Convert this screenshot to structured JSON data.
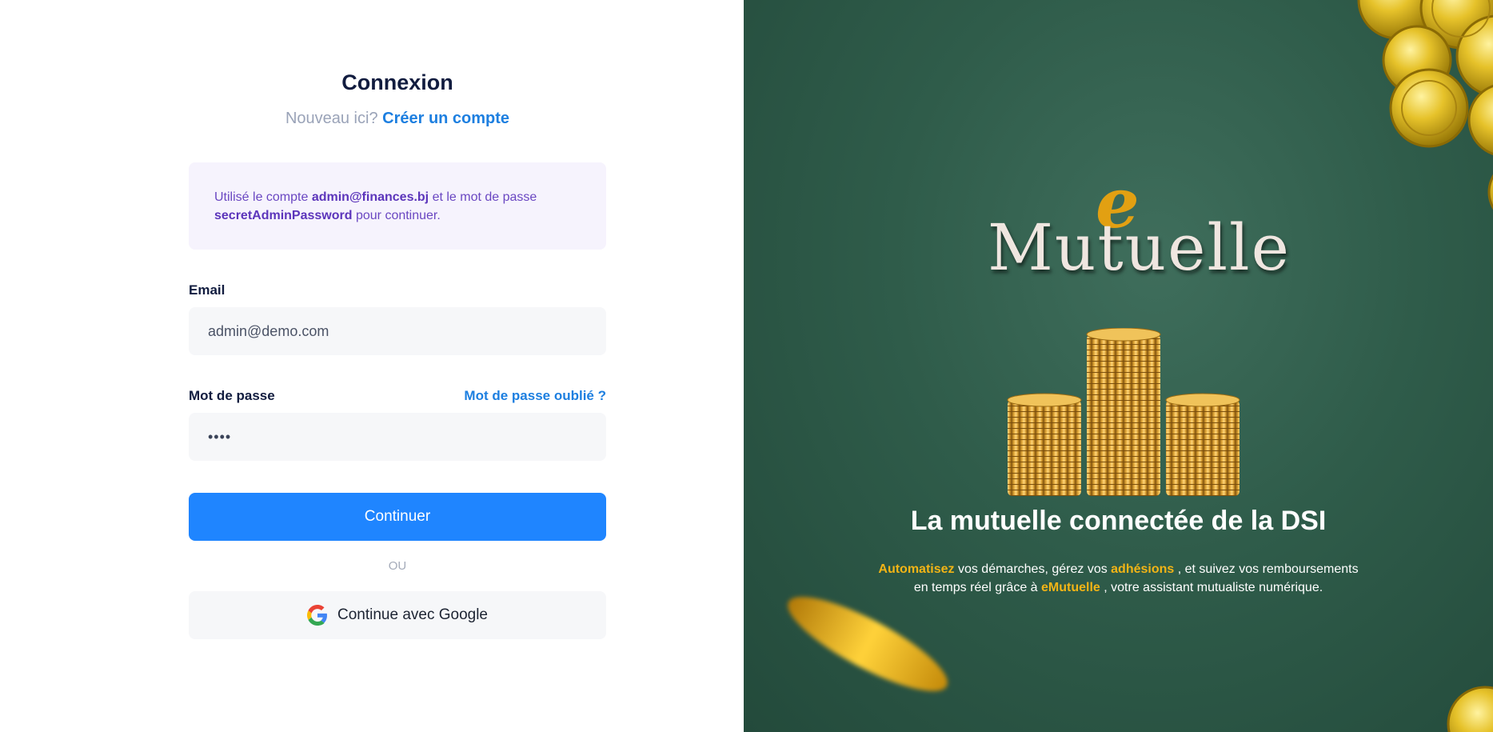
{
  "login": {
    "title": "Connexion",
    "subtitle_text": "Nouveau ici?",
    "create_account_link": "Créer un compte",
    "notice": {
      "prefix": "Utilisé le compte",
      "email": "admin@finances.bj",
      "middle": "et le mot de passe",
      "password": "secretAdminPassword",
      "suffix": "pour continuer."
    },
    "email_label": "Email",
    "email_value": "admin@demo.com",
    "password_label": "Mot de passe",
    "forgot_link": "Mot de passe oublié ?",
    "password_value": "••••",
    "continue_button": "Continuer",
    "or_separator": "OU",
    "google_button": "Continue avec Google"
  },
  "hero": {
    "logo_e": "e",
    "logo_word": "Mutuelle",
    "headline": "La mutuelle connectée de la DSI",
    "desc": {
      "hl1": "Automatisez",
      "t1": " vos démarches, gérez vos ",
      "hl2": "adhésions",
      "t2": " , et suivez vos remboursements",
      "t3": "en temps réel grâce à ",
      "hl3": "eMutuelle",
      "t4": " , votre assistant mutualiste numérique."
    }
  },
  "colors": {
    "primary": "#1f85ff",
    "link": "#1d7fe0",
    "hero_bg": "#2f5c4a",
    "accent_gold": "#f2b416",
    "notice_bg": "#f6f3fd",
    "notice_text": "#6a47c2"
  },
  "icons": {
    "google": "google-icon",
    "coins": "coin-stack-illustration",
    "logo": "emutuelle-logo"
  }
}
